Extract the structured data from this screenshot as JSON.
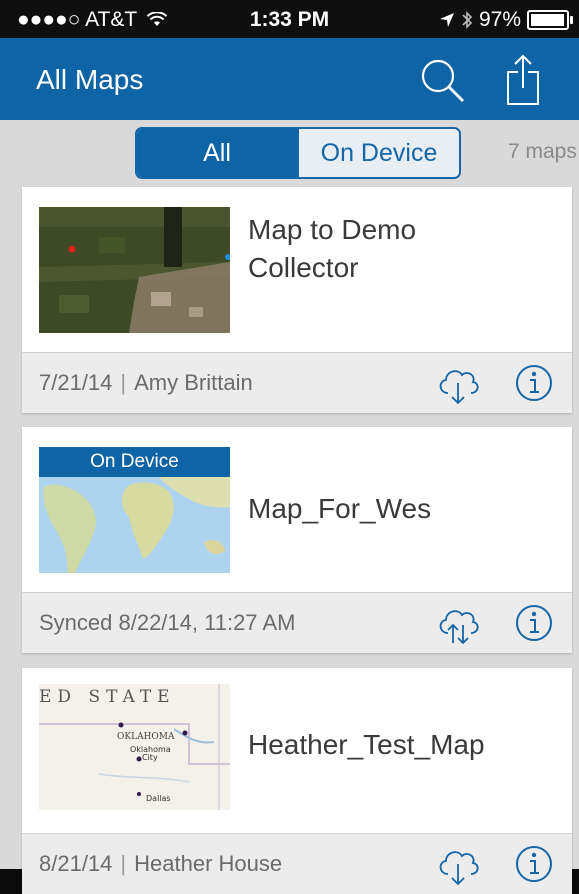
{
  "status_bar": {
    "carrier": "●●●●○ AT&T",
    "time": "1:33 PM",
    "battery": "97%",
    "battery_level": 0.97
  },
  "nav": {
    "title": "All Maps"
  },
  "filter": {
    "options": [
      "All",
      "On Device"
    ],
    "selected": "All",
    "count": "7 maps"
  },
  "maps": [
    {
      "name_line1": "Map to Demo",
      "name_line2": "Collector",
      "date": "7/21/14",
      "owner": "Amy Brittain",
      "badge": ""
    },
    {
      "name_line1": "Map_For_Wes",
      "sync": "Synced 8/22/14, 11:27 AM",
      "badge": "On Device"
    },
    {
      "name_line1": "Heather_Test_Map",
      "date": "8/21/14",
      "owner": "Heather House",
      "badge": ""
    }
  ],
  "map_labels": {
    "header": "ED STATE",
    "state": "OKLAHOMA",
    "city1": "Oklahoma",
    "city1b": "City",
    "city2": "Dallas"
  },
  "colors": {
    "brand_blue": "#0f64a6",
    "background": "#d9d9da"
  }
}
